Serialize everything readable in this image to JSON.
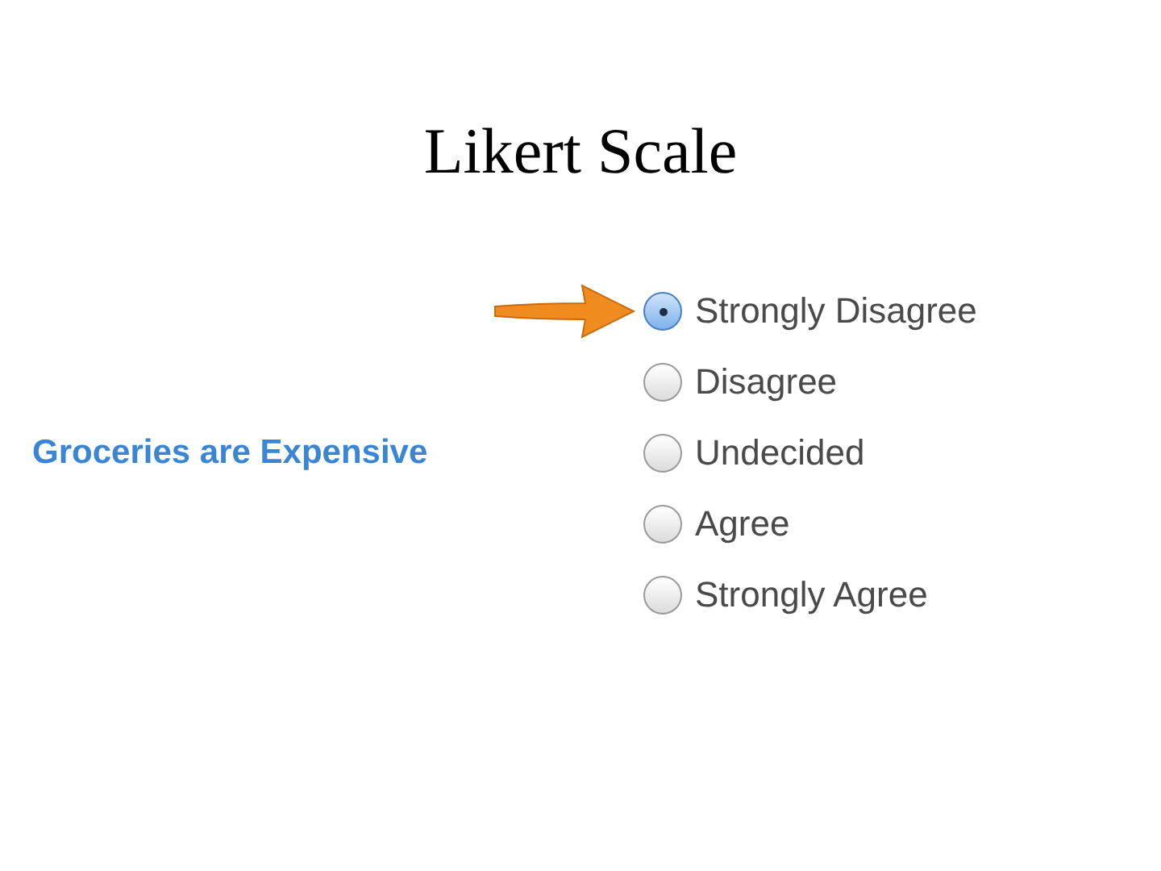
{
  "title": "Likert Scale",
  "question": "Groceries are Expensive",
  "options": [
    {
      "label": "Strongly Disagree",
      "selected": true
    },
    {
      "label": "Disagree",
      "selected": false
    },
    {
      "label": "Undecided",
      "selected": false
    },
    {
      "label": "Agree",
      "selected": false
    },
    {
      "label": "Strongly Agree",
      "selected": false
    }
  ]
}
